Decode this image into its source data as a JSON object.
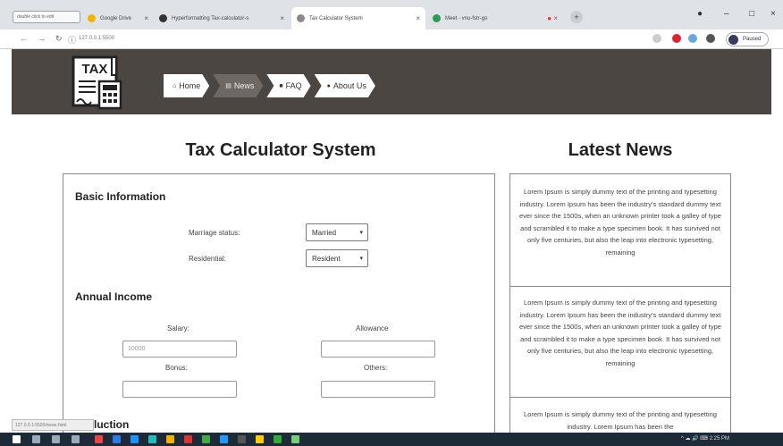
{
  "browser": {
    "tabs": [
      {
        "label": "Google Drive"
      },
      {
        "label": "Hyperformatting Tax-calculator-s"
      },
      {
        "label": "Tax Calculator System"
      },
      {
        "label": "Meet - vnu-fstr-go"
      }
    ],
    "small_tab_label": "double click to edit",
    "url": "127.0.0.1:5500",
    "profile_label": "Paused"
  },
  "nav": {
    "items": [
      {
        "label": "Home",
        "icon": "home-icon"
      },
      {
        "label": "News",
        "icon": "news-icon"
      },
      {
        "label": "FAQ",
        "icon": "faq-icon"
      },
      {
        "label": "About Us",
        "icon": "user-icon"
      }
    ],
    "active_index": 1
  },
  "logo": {
    "text": "TAX"
  },
  "main": {
    "title": "Tax Calculator System",
    "basic": {
      "title": "Basic Information",
      "marriage_label": "Marriage status:",
      "marriage_value": "Married",
      "residential_label": "Residential:",
      "residential_value": "Resident"
    },
    "income": {
      "title": "Annual Income",
      "salary_label": "Salary:",
      "salary_placeholder": "10000",
      "allowance_label": "Allowance",
      "bonus_label": "Bonus:",
      "others_label": "Others:"
    },
    "next_section_tail": "luction"
  },
  "news": {
    "title": "Latest News",
    "items": [
      {
        "text": "Lorem Ipsum is simply dummy text of the printing and typesetting industry. Lorem Ipsum has been the industry's standard dummy text ever since the 1500s, when an unknown printer took a galley of type and scrambled it to make a type specimen book. It has survived not only five centuries, but also the leap into electronic typesetting, remaining"
      },
      {
        "text": "Lorem Ipsum is simply dummy text of the printing and typesetting industry. Lorem Ipsum has been the industry's standard dummy text ever since the 1500s, when an unknown printer took a galley of type and scrambled it to make a type specimen book. It has survived not only five centuries, but also the leap into electronic typesetting, remaining"
      },
      {
        "text": "Lorem Ipsum is simply dummy text of the printing and typesetting industry. Lorem Ipsum has been the"
      }
    ]
  },
  "status_url": "127.0.0.1:5500/news.html",
  "taskbar": {
    "time": "2:25 PM"
  },
  "colors": {
    "header_bg": "#4c4643",
    "active_crumb": "#6e6865"
  }
}
